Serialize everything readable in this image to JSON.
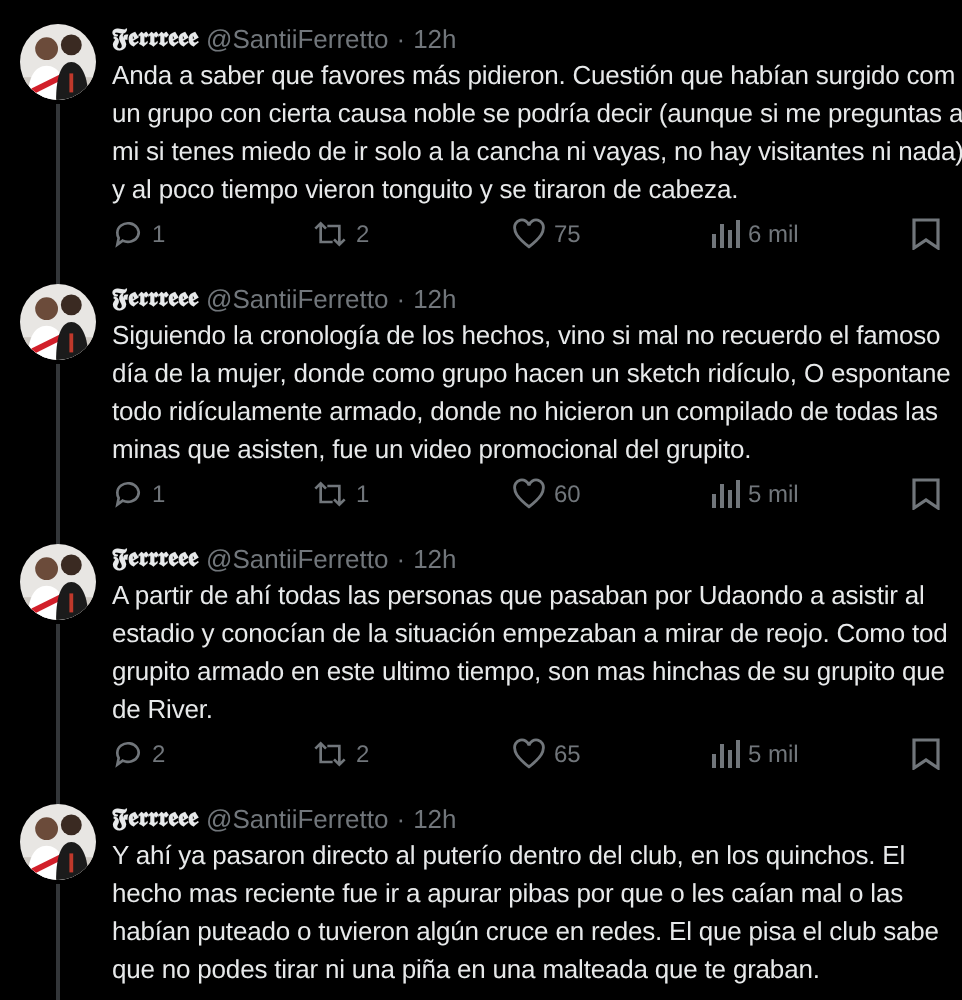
{
  "tweets": [
    {
      "name": "𝕱𝖊𝖗𝖗𝖗𝖊𝖊𝖊",
      "handle": "@SantiiFerretto",
      "separator": "·",
      "time": "12h",
      "lines": [
        "Anda a saber que favores más pidieron. Cuestión que habían surgido com",
        "un grupo con cierta causa noble se podría decir (aunque si me preguntas a",
        "mi si tenes miedo de ir solo a la cancha ni vayas, no hay visitantes ni nada)",
        "y al poco tiempo vieron tonguito y se tiraron de cabeza."
      ],
      "replies": "1",
      "reposts": "2",
      "likes": "75",
      "views": "6 mil"
    },
    {
      "name": "𝕱𝖊𝖗𝖗𝖗𝖊𝖊𝖊",
      "handle": "@SantiiFerretto",
      "separator": "·",
      "time": "12h",
      "lines": [
        "Siguiendo la cronología de los hechos, vino si mal no recuerdo el famoso",
        "día de la mujer, donde como grupo hacen un sketch ridículo, O espontane",
        "todo ridículamente armado, donde no hicieron un compilado de todas las",
        "minas que asisten, fue un video promocional del grupito."
      ],
      "replies": "1",
      "reposts": "1",
      "likes": "60",
      "views": "5 mil"
    },
    {
      "name": "𝕱𝖊𝖗𝖗𝖗𝖊𝖊𝖊",
      "handle": "@SantiiFerretto",
      "separator": "·",
      "time": "12h",
      "lines": [
        "A partir de ahí todas las personas que pasaban por Udaondo a asistir al",
        "estadio y conocían de la situación empezaban a mirar de reojo. Como tod",
        "grupito armado en este ultimo tiempo, son mas hinchas de su grupito que",
        "de River."
      ],
      "replies": "2",
      "reposts": "2",
      "likes": "65",
      "views": "5 mil"
    },
    {
      "name": "𝕱𝖊𝖗𝖗𝖗𝖊𝖊𝖊",
      "handle": "@SantiiFerretto",
      "separator": "·",
      "time": "12h",
      "lines": [
        "Y ahí ya pasaron directo al puterío dentro del club, en los quinchos. El",
        "hecho mas reciente fue ir a apurar pibas por que o les caían mal o las",
        "habían puteado o tuvieron algún cruce en redes. El que pisa el club sabe",
        "que no podes tirar ni una piña en una malteada que te graban."
      ]
    }
  ]
}
